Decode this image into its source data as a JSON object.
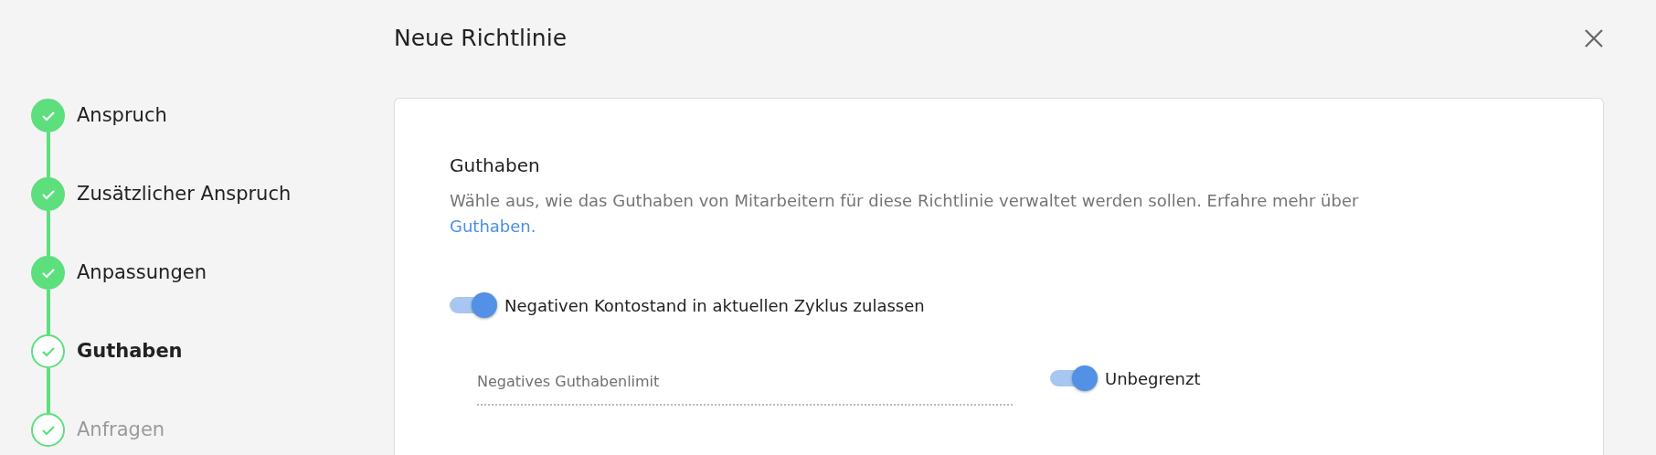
{
  "steps": [
    {
      "label": "Anspruch",
      "kind": "done",
      "selected": false
    },
    {
      "label": "Zusätzlicher Anspruch",
      "kind": "done",
      "selected": false
    },
    {
      "label": "Anpassungen",
      "kind": "done",
      "selected": false
    },
    {
      "label": "Guthaben",
      "kind": "current",
      "selected": true
    },
    {
      "label": "Anfragen",
      "kind": "upcoming",
      "selected": false
    }
  ],
  "dialog": {
    "title": "Neue Richtlinie"
  },
  "section": {
    "title": "Guthaben",
    "description": "Wähle aus, wie das Guthaben von Mitarbeitern für diese Richtlinie verwaltet werden sollen. Erfahre mehr über",
    "link": "Guthaben."
  },
  "negative_balance_toggle": {
    "label": "Negativen Kontostand in aktuellen Zyklus zulassen",
    "on": true
  },
  "limit_field": {
    "placeholder": "Negatives Guthabenlimit"
  },
  "unlimited_toggle": {
    "label": "Unbegrenzt",
    "on": true
  }
}
